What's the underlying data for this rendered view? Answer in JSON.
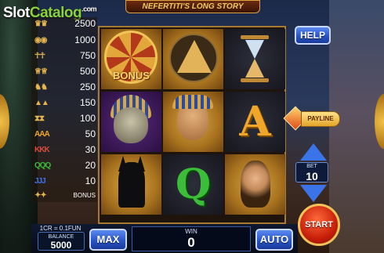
{
  "watermark": {
    "prefix": "Slot",
    "highlight": "Catalog",
    "suffix": ".com"
  },
  "game_title": "NEFERTITI'S LONG STORY",
  "paytable": {
    "rows": [
      {
        "symbol": "wild-pharaoh",
        "payout": "2500"
      },
      {
        "symbol": "bonus-wheel",
        "payout": "1000"
      },
      {
        "symbol": "pharaoh",
        "payout": "750"
      },
      {
        "symbol": "queen",
        "payout": "500"
      },
      {
        "symbol": "anubis",
        "payout": "250"
      },
      {
        "symbol": "pyramid",
        "payout": "150"
      },
      {
        "symbol": "hourglass",
        "payout": "100"
      },
      {
        "symbol": "letter-a",
        "payout": "50"
      },
      {
        "symbol": "letter-k",
        "payout": "30"
      },
      {
        "symbol": "letter-q",
        "payout": "20"
      },
      {
        "symbol": "letter-j",
        "payout": "10"
      },
      {
        "symbol": "scarab-bonus",
        "payout": "BONUS"
      }
    ]
  },
  "reels": {
    "bonus_label": "BONUS",
    "letter_a": "A",
    "letter_q": "Q",
    "symbols": [
      [
        "bonus-wheel",
        "pyramid",
        "hourglass"
      ],
      [
        "skull-pharaoh",
        "pharaoh",
        "letter-a"
      ],
      [
        "anubis",
        "letter-q",
        "queen"
      ]
    ]
  },
  "controls": {
    "help": "HELP",
    "payline": "PAYLINE",
    "bet_label": "BET",
    "bet_value": "10",
    "rate": "1CR = 0.1FUN",
    "balance_label": "BALANCE",
    "balance_value": "5000",
    "max": "MAX",
    "win_label": "WIN",
    "win_value": "0",
    "auto": "AUTO",
    "start": "START"
  },
  "colors": {
    "accent_gold": "#d9a742",
    "button_blue": "#2a55c8",
    "start_red": "#c8200a"
  }
}
